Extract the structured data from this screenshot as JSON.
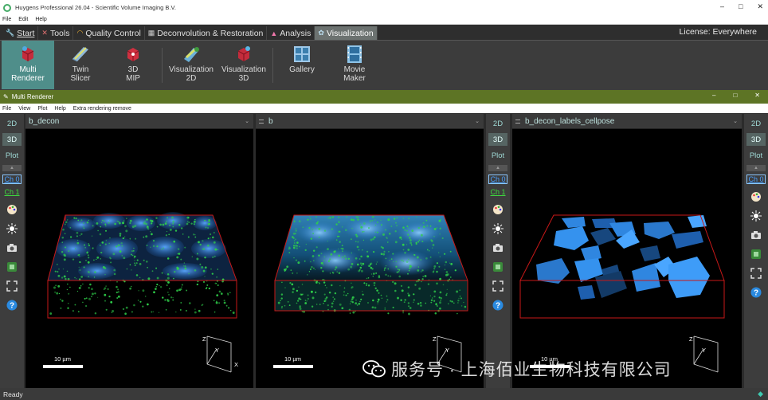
{
  "window": {
    "title": "Huygens Professional 26.04 - Scientific Volume Imaging B.V.",
    "min": "–",
    "max": "□",
    "close": "✕"
  },
  "menu": [
    "File",
    "Edit",
    "Help"
  ],
  "ribbon_tabs": [
    {
      "label": "Start",
      "icon": "wrench-icon"
    },
    {
      "label": "Tools",
      "icon": "tools-icon"
    },
    {
      "label": "Quality Control",
      "icon": "rainbow-icon"
    },
    {
      "label": "Deconvolution & Restoration",
      "icon": "deconvolution-icon"
    },
    {
      "label": "Analysis",
      "icon": "analysis-icon"
    },
    {
      "label": "Visualization",
      "icon": "visualization-icon",
      "active": true
    }
  ],
  "license": "License: Everywhere",
  "ribbon_buttons": [
    {
      "label1": "Multi",
      "label2": "Renderer",
      "icon": "multi-renderer-icon",
      "active": true
    },
    {
      "label1": "Twin",
      "label2": "Slicer",
      "icon": "twin-slicer-icon"
    },
    {
      "label1": "3D",
      "label2": "MIP",
      "icon": "mip-icon"
    },
    {
      "label1": "Visualization",
      "label2": "2D",
      "icon": "visualization-2d-icon"
    },
    {
      "label1": "Visualization",
      "label2": "3D",
      "icon": "visualization-3d-icon"
    },
    {
      "label1": "Gallery",
      "label2": "",
      "icon": "gallery-icon"
    },
    {
      "label1": "Movie",
      "label2": "Maker",
      "icon": "movie-maker-icon"
    }
  ],
  "subwindow": {
    "title": "Multi Renderer",
    "min": "–",
    "max": "□",
    "close": "✕"
  },
  "submenu": [
    "File",
    "View",
    "Plot",
    "Help",
    "Extra rendering remove"
  ],
  "modes": [
    "2D",
    "3D",
    "Plot"
  ],
  "channels": [
    "Ch 0",
    "Ch 1"
  ],
  "viewports": [
    {
      "name": "b_decon",
      "scale": "10 µm"
    },
    {
      "name": "b",
      "scale": "10 µm"
    },
    {
      "name": "b_decon_labels_cellpose",
      "scale": "10 µm"
    }
  ],
  "axes": {
    "z": "Z",
    "y": "Y",
    "x": "X"
  },
  "status": "Ready",
  "watermark": "服务号 · 上海佰业生物科技有限公司",
  "colors": {
    "accent": "#4f8e8a",
    "subbar": "#5d7425",
    "bbox": "#c81818",
    "nuclei": "#2a7bd6",
    "spots": "#2fd04a"
  }
}
